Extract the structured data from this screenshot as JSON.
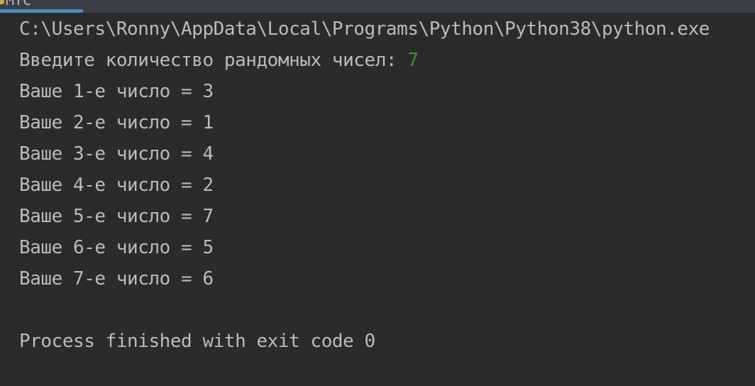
{
  "header": {
    "tab_title": "MTC",
    "tab_icon": "python-file-icon"
  },
  "colors": {
    "background": "#2b2b2b",
    "text": "#bbbbbb",
    "user_input": "#2e9a2e",
    "tab_accent": "#4a88c7"
  },
  "console": {
    "command": "C:\\Users\\Ronny\\AppData\\Local\\Programs\\Python\\Python38\\python.exe",
    "prompt": "Введите количество рандомных чисел: ",
    "prompt_input": "7",
    "results": [
      "Ваше 1-е число = 3",
      "Ваше 2-е число = 1",
      "Ваше 3-е число = 4",
      "Ваше 4-е число = 2",
      "Ваше 5-е число = 7",
      "Ваше 6-е число = 5",
      "Ваше 7-е число = 6"
    ],
    "exit_message": "Process finished with exit code 0"
  }
}
